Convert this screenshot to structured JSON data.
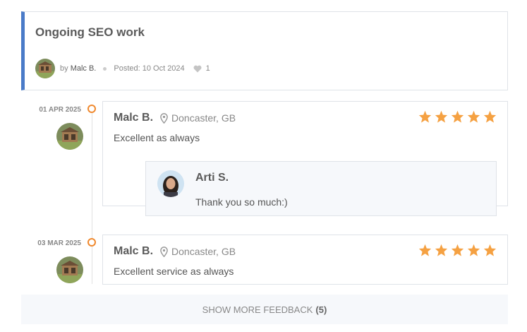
{
  "job": {
    "title": "Ongoing SEO work",
    "by_prefix": "by",
    "author": "Malc B.",
    "posted": "Posted: 10 Oct 2024",
    "likes": "1",
    "icons": {
      "avatar": "shed-photo-avatar",
      "like": "heart-icon"
    }
  },
  "feedback": [
    {
      "date": "01 APR 2025",
      "name": "Malc B.",
      "location": "Doncaster, GB",
      "rating": 5,
      "text": "Excellent as always",
      "reply": {
        "name": "Arti S.",
        "text": "Thank you so much:)"
      }
    },
    {
      "date": "03 MAR 2025",
      "name": "Malc B.",
      "location": "Doncaster, GB",
      "rating": 5,
      "text": "Excellent service as always"
    }
  ],
  "show_more": {
    "label": "SHOW MORE FEEDBACK",
    "count": "(5)"
  },
  "colors": {
    "accent_border": "#4a7bc8",
    "star": "#f5a142",
    "timeline_dot": "#f0892e"
  }
}
